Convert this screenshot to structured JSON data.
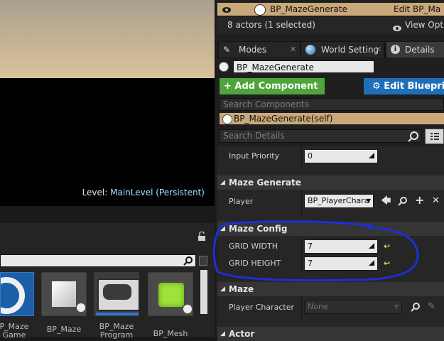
{
  "viewport": {
    "level_prefix": "Level:",
    "level_name": "MainLevel (Persistent)"
  },
  "outliner": {
    "row_label": "BP_MazeGenerate",
    "row_type": "Edit BP_Ma",
    "actor_count": "8 actors (1 selected)",
    "view_options": "View Optio"
  },
  "tabs": [
    {
      "label": "Modes"
    },
    {
      "label": "World Setting"
    },
    {
      "label": "Details"
    }
  ],
  "details": {
    "actor_name": "BP_MazeGenerate",
    "add_component": "+ Add Component",
    "edit_blueprint": "Edit Blueprin",
    "search_components_placeholder": "Search Components",
    "component_self": "BP_MazeGenerate(self)",
    "search_details_placeholder": "Search Details",
    "input_priority_label": "Input Priority",
    "input_priority_value": "0",
    "maze_generate_header": "Maze Generate",
    "player_label": "Player",
    "player_value": "BP_PlayerChara",
    "maze_config_header": "Maze Config",
    "grid_width_label": "GRID WIDTH",
    "grid_width_value": "7",
    "grid_height_label": "GRID HEIGHT",
    "grid_height_value": "7",
    "maze_header": "Maze",
    "player_character_label": "Player Character",
    "player_character_value": "None",
    "actor_header": "Actor"
  },
  "content_browser": {
    "tiles": [
      {
        "label_line1": "P_Maze",
        "label_line2": "Game"
      },
      {
        "label_line1": "BP_Maze",
        "label_line2": "..."
      },
      {
        "label_line1": "BP_Maze",
        "label_line2": "Program"
      },
      {
        "label_line1": "BP_Mesh",
        "label_line2": ""
      }
    ]
  },
  "colors": {
    "accent_green": "#4fa43a",
    "accent_blue": "#1f6fb8",
    "annotation": "#1c2fd6"
  }
}
